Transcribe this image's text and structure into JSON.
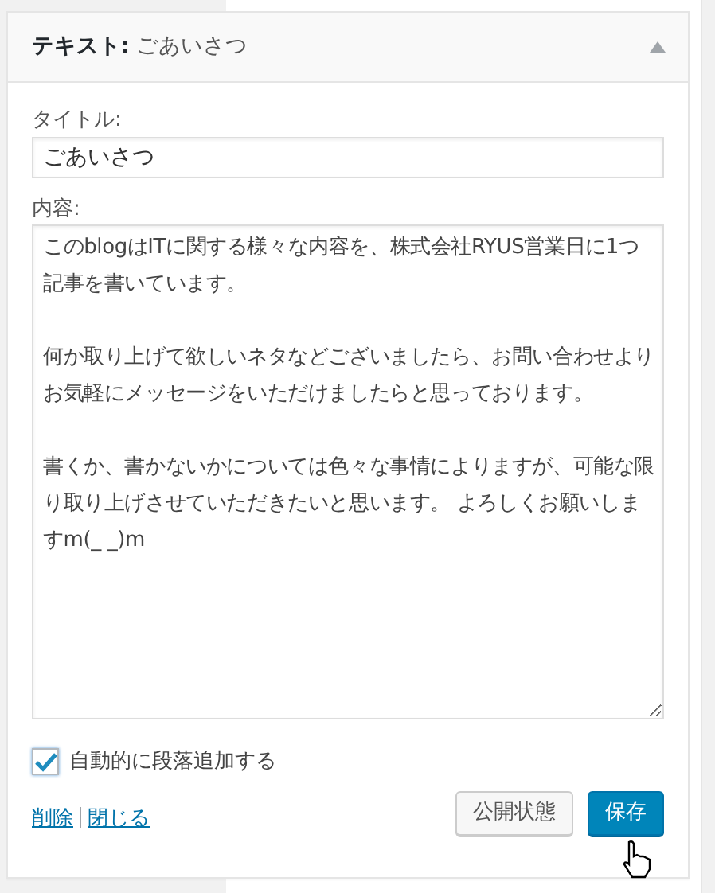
{
  "widget": {
    "title": "**テキスト:** ごあいさつ",
    "expanded": true
  },
  "fields": [
    {
      "kind": "input",
      "label": "タイトル:",
      "value": "ごあいさつ"
    },
    {
      "kind": "textarea",
      "label": "内容:",
      "paragraphs": [
        "このblogはITに関する様々な内容を、株式会社RYUS営業日に1つ記事を書いています。",
        "何か取り上げて欲しいネタなどございましたら、お問い合わせよりお気軽にメッセージをいただけましたらと思っております。",
        "書くか、書かないかについては色々な事情によりますが、可能な限り取り上げさせていただきたいと思います。 よろしくお願いしますm(_ _)m"
      ]
    }
  ],
  "auto_paragraph": {
    "label": "自動的に段落追加する",
    "checked": true
  },
  "links": [
    "削除",
    "閉じる"
  ],
  "buttons": [
    {
      "label": "公開状態",
      "kind": "secondary"
    },
    {
      "label": "保存",
      "kind": "primary"
    }
  ]
}
